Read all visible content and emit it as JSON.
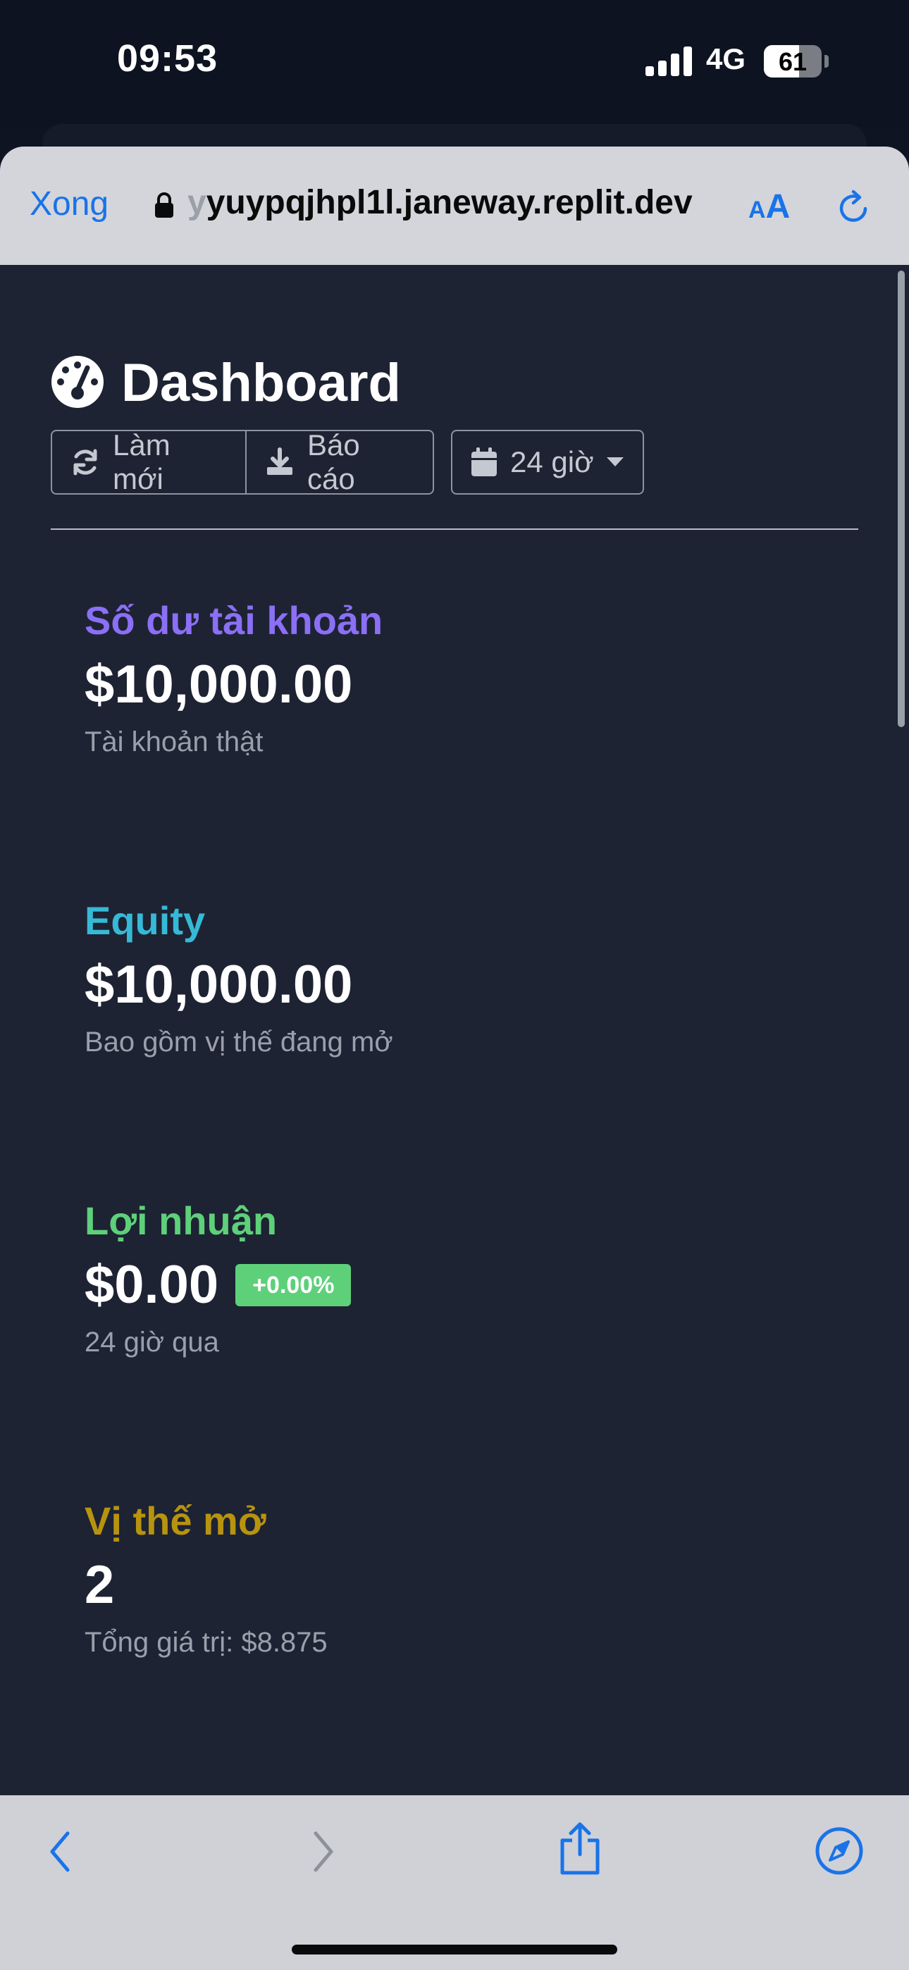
{
  "status_bar": {
    "time": "09:53",
    "network": "4G",
    "battery": "61",
    "battery_level": 0.61
  },
  "browser": {
    "done_label": "Xong",
    "url_fade": "y",
    "url_main": "yuypqjhpl1l.janeway.replit.dev",
    "text_size_label_small": "A",
    "text_size_label_large": "A",
    "accent_color": "#1a73e8"
  },
  "dashboard": {
    "title": "Dashboard",
    "refresh_label": "Làm mới",
    "report_label": "Báo cáo",
    "period_label": "24 giờ"
  },
  "cards": [
    {
      "title": "Số dư tài khoản",
      "value": "$10,000.00",
      "subtitle": "Tài khoản thật",
      "color": "#8b6ff5"
    },
    {
      "title": "Equity",
      "value": "$10,000.00",
      "subtitle": "Bao gồm vị thế đang mở",
      "color": "#36b9d6"
    },
    {
      "title": "Lợi nhuận",
      "value": "$0.00",
      "badge": "+0.00%",
      "subtitle": "24 giờ qua",
      "color": "#5ed07a"
    },
    {
      "title": "Vị thế mở",
      "value": "2",
      "subtitle": "Tổng giá trị: $8.875",
      "color": "#b8940e"
    }
  ]
}
